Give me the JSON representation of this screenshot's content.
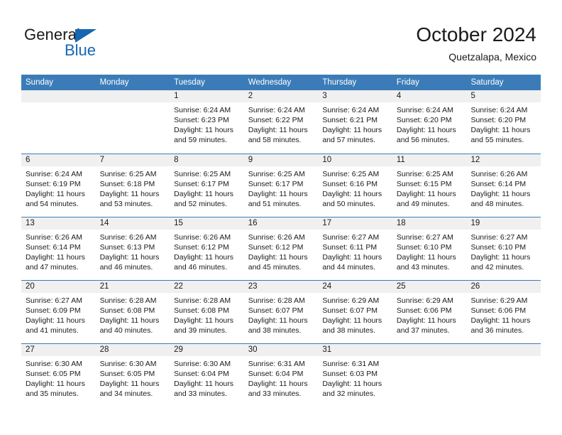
{
  "brand": {
    "name_part1": "General",
    "name_part2": "Blue",
    "accent_color": "#1567b3"
  },
  "header": {
    "title": "October 2024",
    "subtitle": "Quetzalapa, Mexico"
  },
  "calendar": {
    "header_color": "#3b7cb8",
    "weekdays": [
      "Sunday",
      "Monday",
      "Tuesday",
      "Wednesday",
      "Thursday",
      "Friday",
      "Saturday"
    ],
    "weeks": [
      [
        {
          "day": "",
          "sunrise": "",
          "sunset": "",
          "daylight": "",
          "empty": true
        },
        {
          "day": "",
          "sunrise": "",
          "sunset": "",
          "daylight": "",
          "empty": true
        },
        {
          "day": "1",
          "sunrise": "Sunrise: 6:24 AM",
          "sunset": "Sunset: 6:23 PM",
          "daylight": "Daylight: 11 hours and 59 minutes."
        },
        {
          "day": "2",
          "sunrise": "Sunrise: 6:24 AM",
          "sunset": "Sunset: 6:22 PM",
          "daylight": "Daylight: 11 hours and 58 minutes."
        },
        {
          "day": "3",
          "sunrise": "Sunrise: 6:24 AM",
          "sunset": "Sunset: 6:21 PM",
          "daylight": "Daylight: 11 hours and 57 minutes."
        },
        {
          "day": "4",
          "sunrise": "Sunrise: 6:24 AM",
          "sunset": "Sunset: 6:20 PM",
          "daylight": "Daylight: 11 hours and 56 minutes."
        },
        {
          "day": "5",
          "sunrise": "Sunrise: 6:24 AM",
          "sunset": "Sunset: 6:20 PM",
          "daylight": "Daylight: 11 hours and 55 minutes."
        }
      ],
      [
        {
          "day": "6",
          "sunrise": "Sunrise: 6:24 AM",
          "sunset": "Sunset: 6:19 PM",
          "daylight": "Daylight: 11 hours and 54 minutes."
        },
        {
          "day": "7",
          "sunrise": "Sunrise: 6:25 AM",
          "sunset": "Sunset: 6:18 PM",
          "daylight": "Daylight: 11 hours and 53 minutes."
        },
        {
          "day": "8",
          "sunrise": "Sunrise: 6:25 AM",
          "sunset": "Sunset: 6:17 PM",
          "daylight": "Daylight: 11 hours and 52 minutes."
        },
        {
          "day": "9",
          "sunrise": "Sunrise: 6:25 AM",
          "sunset": "Sunset: 6:17 PM",
          "daylight": "Daylight: 11 hours and 51 minutes."
        },
        {
          "day": "10",
          "sunrise": "Sunrise: 6:25 AM",
          "sunset": "Sunset: 6:16 PM",
          "daylight": "Daylight: 11 hours and 50 minutes."
        },
        {
          "day": "11",
          "sunrise": "Sunrise: 6:25 AM",
          "sunset": "Sunset: 6:15 PM",
          "daylight": "Daylight: 11 hours and 49 minutes."
        },
        {
          "day": "12",
          "sunrise": "Sunrise: 6:26 AM",
          "sunset": "Sunset: 6:14 PM",
          "daylight": "Daylight: 11 hours and 48 minutes."
        }
      ],
      [
        {
          "day": "13",
          "sunrise": "Sunrise: 6:26 AM",
          "sunset": "Sunset: 6:14 PM",
          "daylight": "Daylight: 11 hours and 47 minutes."
        },
        {
          "day": "14",
          "sunrise": "Sunrise: 6:26 AM",
          "sunset": "Sunset: 6:13 PM",
          "daylight": "Daylight: 11 hours and 46 minutes."
        },
        {
          "day": "15",
          "sunrise": "Sunrise: 6:26 AM",
          "sunset": "Sunset: 6:12 PM",
          "daylight": "Daylight: 11 hours and 46 minutes."
        },
        {
          "day": "16",
          "sunrise": "Sunrise: 6:26 AM",
          "sunset": "Sunset: 6:12 PM",
          "daylight": "Daylight: 11 hours and 45 minutes."
        },
        {
          "day": "17",
          "sunrise": "Sunrise: 6:27 AM",
          "sunset": "Sunset: 6:11 PM",
          "daylight": "Daylight: 11 hours and 44 minutes."
        },
        {
          "day": "18",
          "sunrise": "Sunrise: 6:27 AM",
          "sunset": "Sunset: 6:10 PM",
          "daylight": "Daylight: 11 hours and 43 minutes."
        },
        {
          "day": "19",
          "sunrise": "Sunrise: 6:27 AM",
          "sunset": "Sunset: 6:10 PM",
          "daylight": "Daylight: 11 hours and 42 minutes."
        }
      ],
      [
        {
          "day": "20",
          "sunrise": "Sunrise: 6:27 AM",
          "sunset": "Sunset: 6:09 PM",
          "daylight": "Daylight: 11 hours and 41 minutes."
        },
        {
          "day": "21",
          "sunrise": "Sunrise: 6:28 AM",
          "sunset": "Sunset: 6:08 PM",
          "daylight": "Daylight: 11 hours and 40 minutes."
        },
        {
          "day": "22",
          "sunrise": "Sunrise: 6:28 AM",
          "sunset": "Sunset: 6:08 PM",
          "daylight": "Daylight: 11 hours and 39 minutes."
        },
        {
          "day": "23",
          "sunrise": "Sunrise: 6:28 AM",
          "sunset": "Sunset: 6:07 PM",
          "daylight": "Daylight: 11 hours and 38 minutes."
        },
        {
          "day": "24",
          "sunrise": "Sunrise: 6:29 AM",
          "sunset": "Sunset: 6:07 PM",
          "daylight": "Daylight: 11 hours and 38 minutes."
        },
        {
          "day": "25",
          "sunrise": "Sunrise: 6:29 AM",
          "sunset": "Sunset: 6:06 PM",
          "daylight": "Daylight: 11 hours and 37 minutes."
        },
        {
          "day": "26",
          "sunrise": "Sunrise: 6:29 AM",
          "sunset": "Sunset: 6:06 PM",
          "daylight": "Daylight: 11 hours and 36 minutes."
        }
      ],
      [
        {
          "day": "27",
          "sunrise": "Sunrise: 6:30 AM",
          "sunset": "Sunset: 6:05 PM",
          "daylight": "Daylight: 11 hours and 35 minutes."
        },
        {
          "day": "28",
          "sunrise": "Sunrise: 6:30 AM",
          "sunset": "Sunset: 6:05 PM",
          "daylight": "Daylight: 11 hours and 34 minutes."
        },
        {
          "day": "29",
          "sunrise": "Sunrise: 6:30 AM",
          "sunset": "Sunset: 6:04 PM",
          "daylight": "Daylight: 11 hours and 33 minutes."
        },
        {
          "day": "30",
          "sunrise": "Sunrise: 6:31 AM",
          "sunset": "Sunset: 6:04 PM",
          "daylight": "Daylight: 11 hours and 33 minutes."
        },
        {
          "day": "31",
          "sunrise": "Sunrise: 6:31 AM",
          "sunset": "Sunset: 6:03 PM",
          "daylight": "Daylight: 11 hours and 32 minutes."
        },
        {
          "day": "",
          "sunrise": "",
          "sunset": "",
          "daylight": "",
          "empty": true
        },
        {
          "day": "",
          "sunrise": "",
          "sunset": "",
          "daylight": "",
          "empty": true
        }
      ]
    ]
  }
}
